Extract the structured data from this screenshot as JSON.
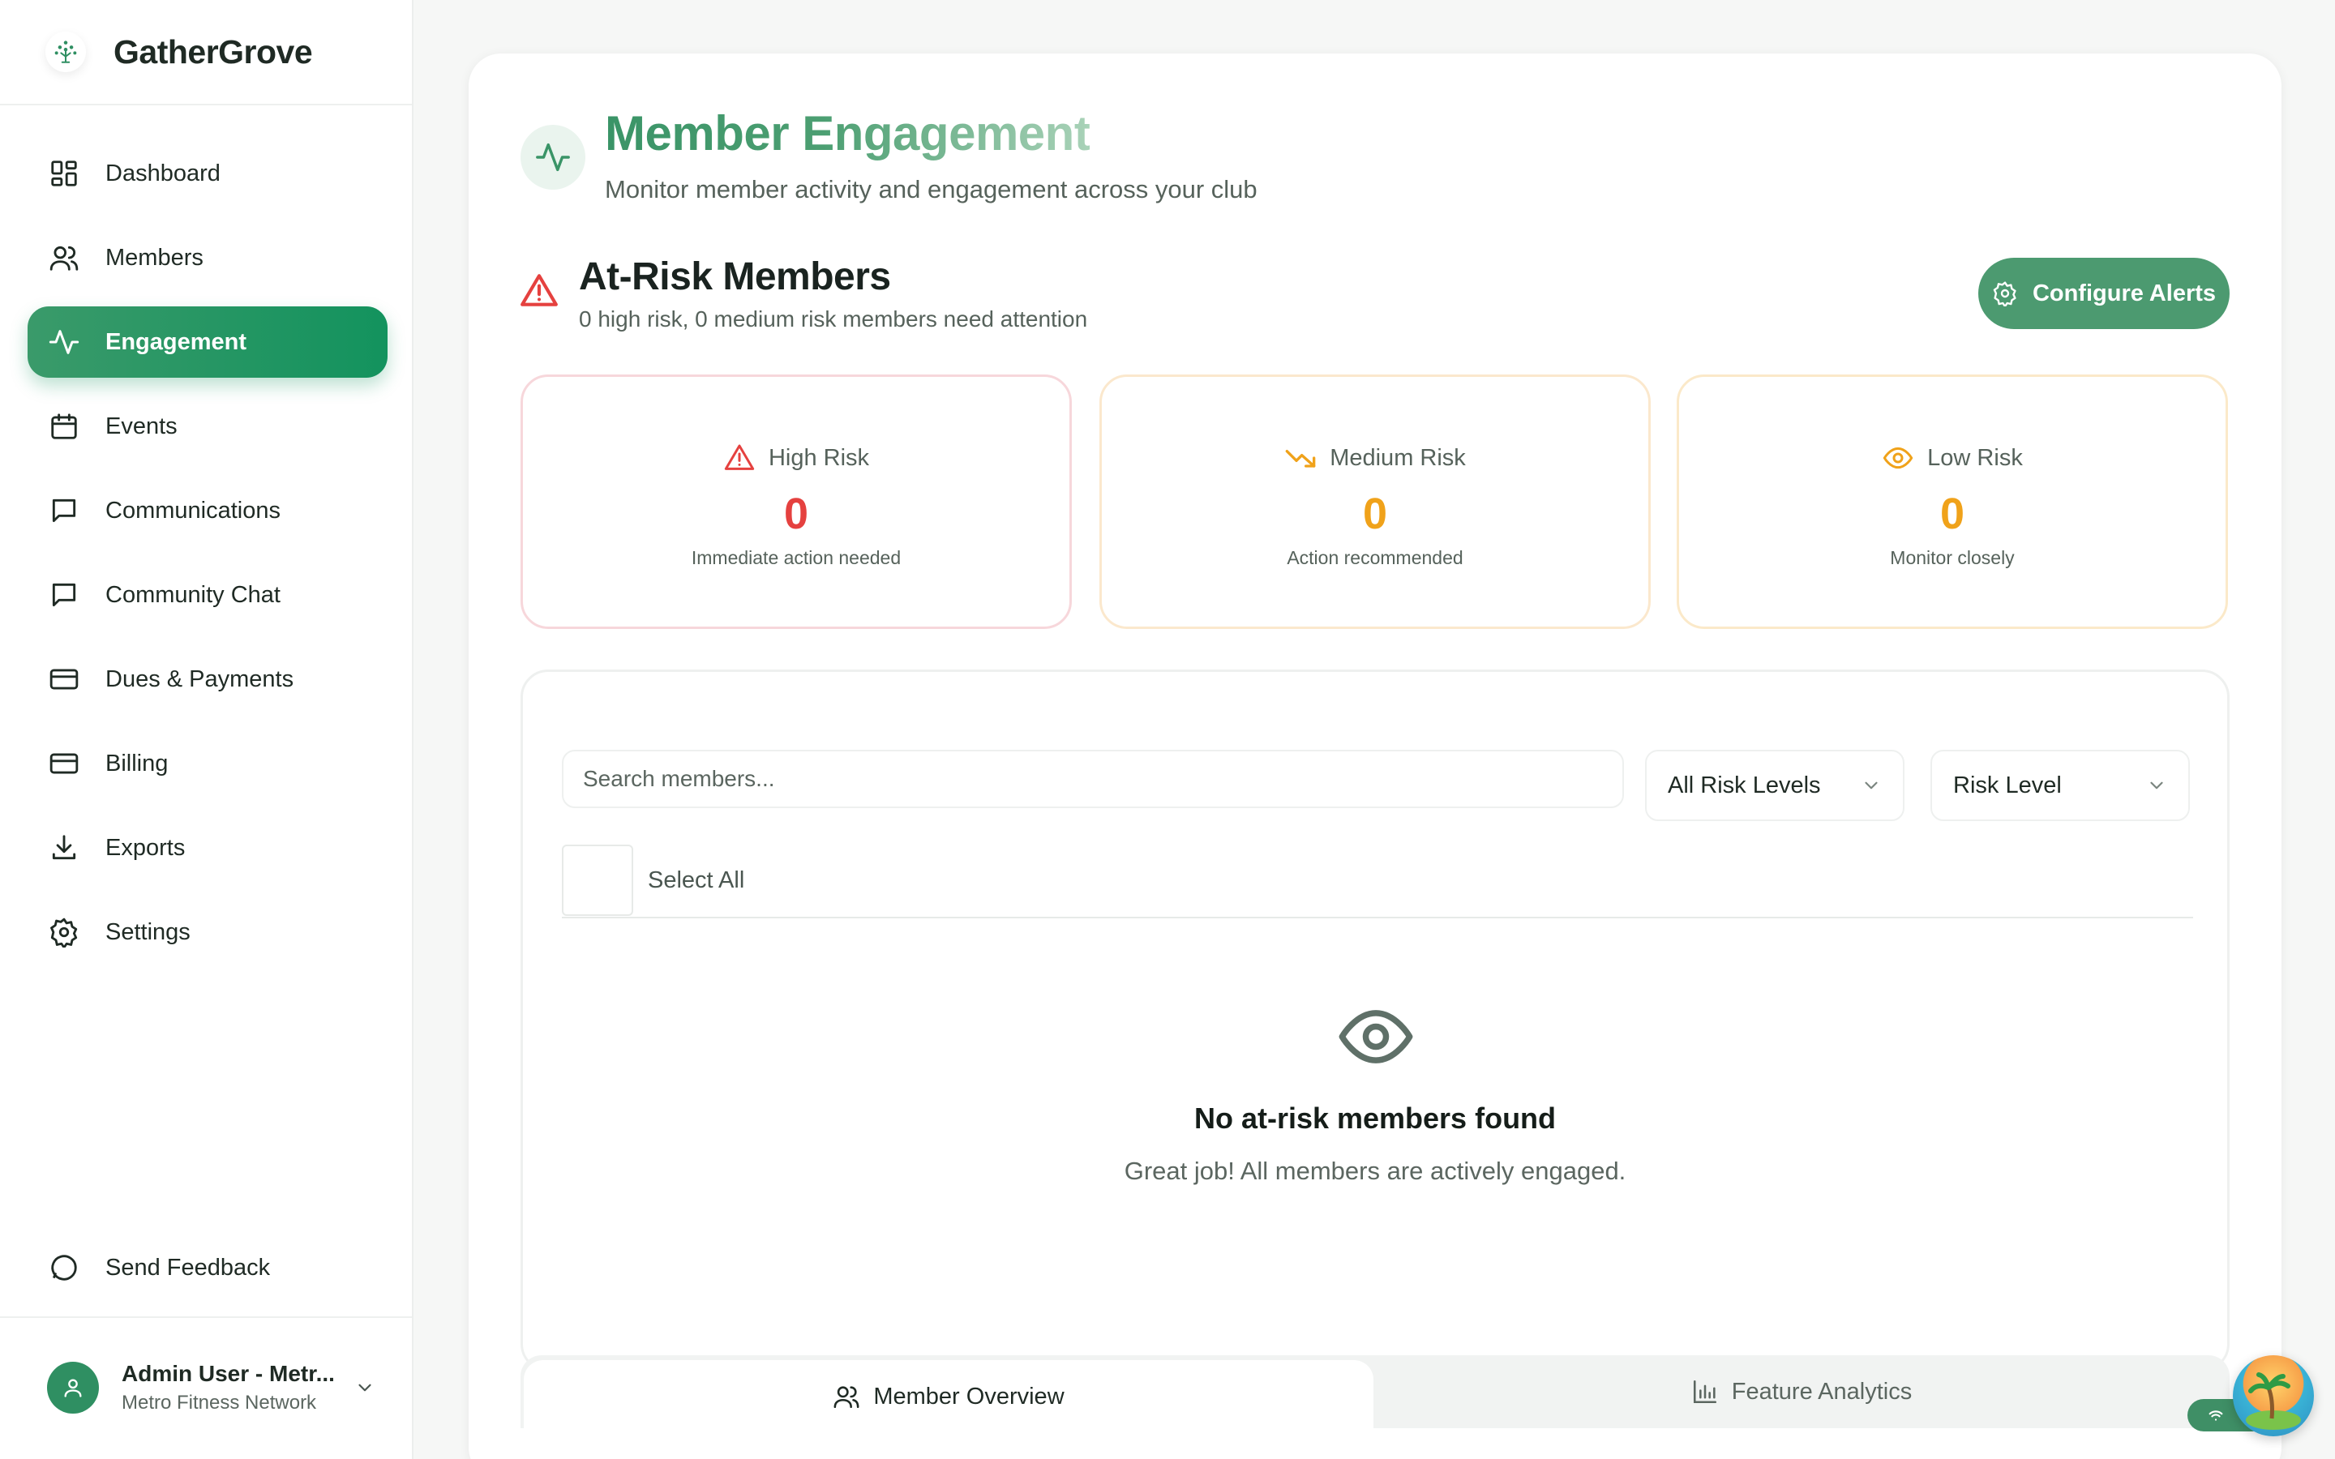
{
  "brand": {
    "name": "GatherGrove"
  },
  "sidebar": {
    "items": [
      {
        "label": "Dashboard",
        "icon": "dashboard-icon",
        "active": false
      },
      {
        "label": "Members",
        "icon": "users-icon",
        "active": false
      },
      {
        "label": "Engagement",
        "icon": "activity-icon",
        "active": true
      },
      {
        "label": "Events",
        "icon": "calendar-icon",
        "active": false
      },
      {
        "label": "Communications",
        "icon": "message-square-icon",
        "active": false
      },
      {
        "label": "Community Chat",
        "icon": "message-square-icon",
        "active": false
      },
      {
        "label": "Dues & Payments",
        "icon": "credit-card-icon",
        "active": false
      },
      {
        "label": "Billing",
        "icon": "credit-card-icon",
        "active": false
      },
      {
        "label": "Exports",
        "icon": "download-icon",
        "active": false
      },
      {
        "label": "Settings",
        "icon": "gear-icon",
        "active": false
      }
    ],
    "feedback_label": "Send Feedback",
    "user": {
      "name": "Admin User - Metr...",
      "org": "Metro Fitness Network"
    }
  },
  "page": {
    "title": "Member Engagement",
    "subtitle": "Monitor member activity and engagement across your club"
  },
  "at_risk": {
    "title": "At-Risk Members",
    "subtitle": "0 high risk, 0 medium risk members need attention",
    "configure_label": "Configure Alerts",
    "cards": {
      "high": {
        "label": "High Risk",
        "value": "0",
        "desc": "Immediate action needed"
      },
      "medium": {
        "label": "Medium Risk",
        "value": "0",
        "desc": "Action recommended"
      },
      "low": {
        "label": "Low Risk",
        "value": "0",
        "desc": "Monitor closely"
      }
    }
  },
  "list": {
    "search_placeholder": "Search members...",
    "risk_filter_value": "All Risk Levels",
    "sort_value": "Risk Level",
    "select_all_label": "Select All",
    "empty_title": "No at-risk members found",
    "empty_subtitle": "Great job! All members are actively engaged."
  },
  "tabs": [
    {
      "label": "Member Overview",
      "active": true
    },
    {
      "label": "Feature Analytics",
      "active": false
    }
  ],
  "colors": {
    "accent": "#13935e",
    "high": "#e5413f",
    "medium": "#f0a21a",
    "low": "#f0a21a"
  }
}
